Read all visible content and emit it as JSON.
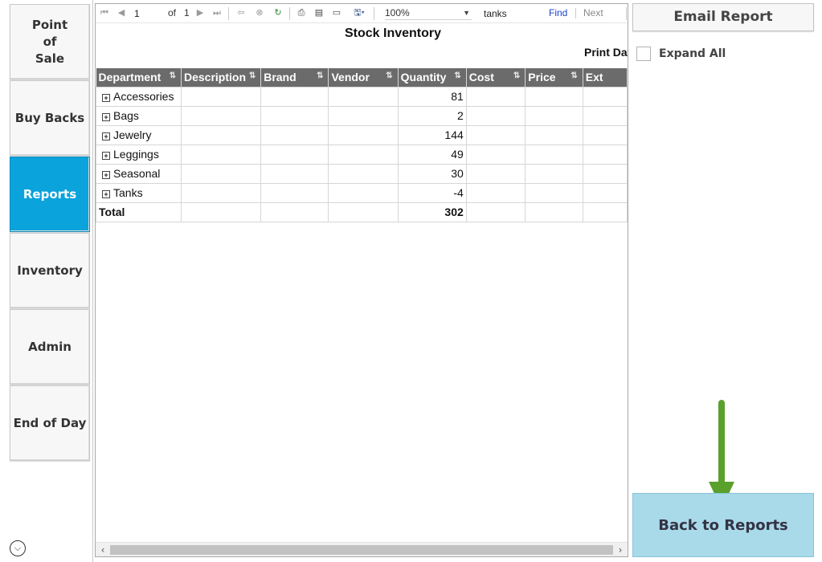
{
  "nav": {
    "items": [
      {
        "label": "Point\nof\nSale",
        "active": false
      },
      {
        "label": "Buy Backs",
        "active": false
      },
      {
        "label": "Reports",
        "active": true
      },
      {
        "label": "Inventory",
        "active": false
      },
      {
        "label": "Admin",
        "active": false
      },
      {
        "label": "End of Day",
        "active": false
      }
    ],
    "scroll_icon": "chevron-down-circle-icon"
  },
  "toolbar": {
    "page_current": "1",
    "page_of": "of",
    "page_total": "1",
    "zoom": "100%",
    "search_value": "tanks",
    "find_label": "Find",
    "next_label": "Next"
  },
  "report": {
    "title": "Stock Inventory",
    "print_date_label": "Print Dat",
    "columns": [
      "Department",
      "Description",
      "Brand",
      "Vendor",
      "Quantity",
      "Cost",
      "Price",
      "Ext"
    ],
    "rows": [
      {
        "department": "Accessories",
        "quantity": "81"
      },
      {
        "department": "Bags",
        "quantity": "2"
      },
      {
        "department": "Jewelry",
        "quantity": "144"
      },
      {
        "department": "Leggings",
        "quantity": "49"
      },
      {
        "department": "Seasonal",
        "quantity": "30"
      },
      {
        "department": "Tanks",
        "quantity": "-4"
      }
    ],
    "total_label": "Total",
    "total_quantity": "302"
  },
  "right_panel": {
    "email_label": "Email Report",
    "expand_all_label": "Expand All",
    "expand_all_checked": false,
    "back_label": "Back to Reports"
  },
  "colors": {
    "nav_active": "#0aa3dc",
    "table_header": "#6b6b6b",
    "back_button": "#a9daea",
    "indicator_arrow": "#5aa02c"
  }
}
